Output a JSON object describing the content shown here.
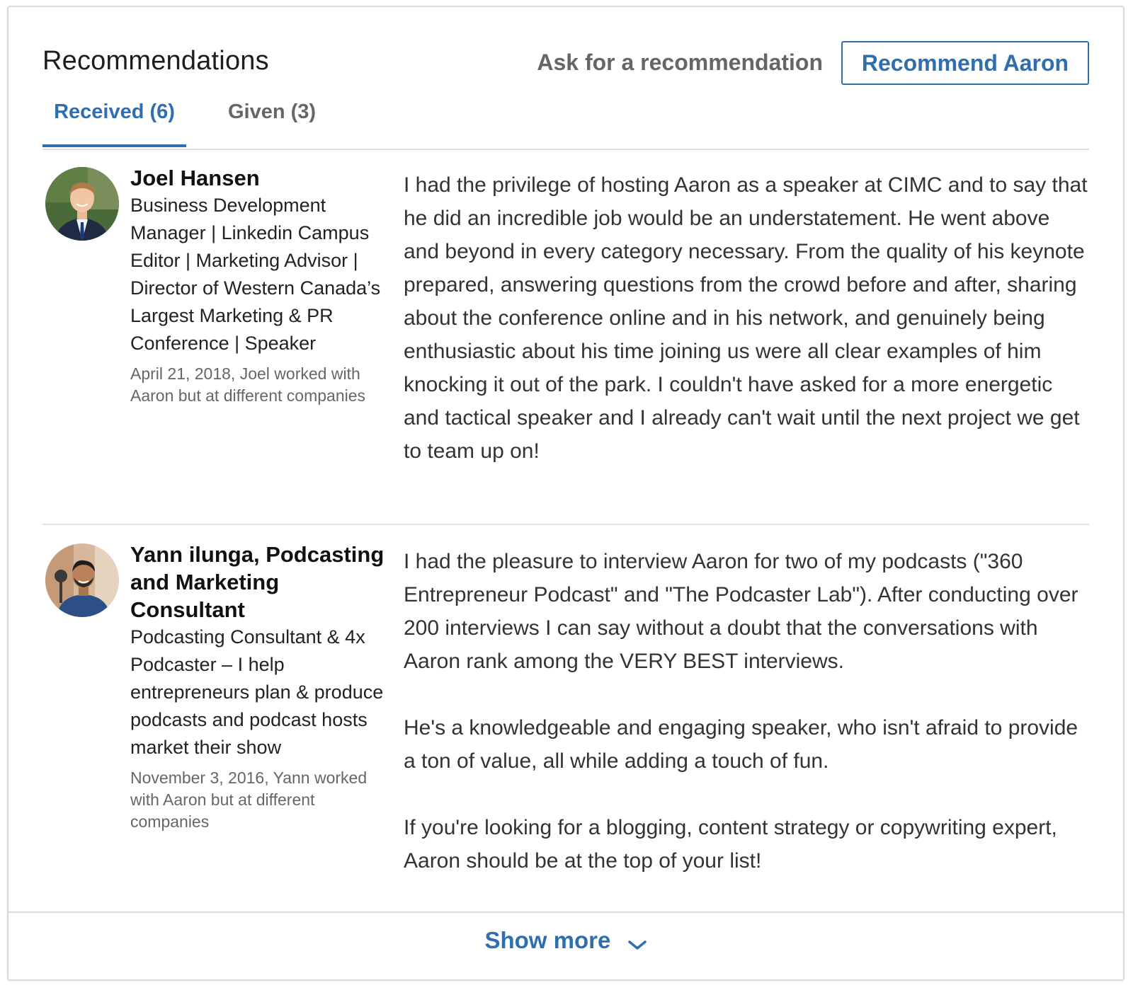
{
  "header": {
    "title": "Recommendations",
    "ask_link": "Ask for a recommendation",
    "recommend_button": "Recommend Aaron"
  },
  "tabs": [
    {
      "label": "Received (6)",
      "active": true
    },
    {
      "label": "Given (3)",
      "active": false
    }
  ],
  "recommendations": [
    {
      "name": "Joel Hansen",
      "headline": "Business Development Manager | Linkedin Campus Editor | Marketing Advisor | Director of Western Canada’s Largest Marketing & PR Conference | Speaker",
      "meta": "April 21, 2018, Joel worked with Aaron but at different companies",
      "paragraphs": [
        "I had the privilege of hosting Aaron as a speaker at CIMC and to say that he did an incredible job would be an understatement. He went above and beyond in every category necessary. From the quality of his keynote prepared, answering questions from the crowd before and after, sharing about the conference online and in his network, and genuinely being enthusiastic about his time joining us were all clear examples of him knocking it out of the park. I couldn't have asked for a more energetic and tactical speaker and I already can't wait until the next project we get to team up on!"
      ]
    },
    {
      "name": "Yann ilunga, Podcasting and Marketing Consultant",
      "headline": "Podcasting Consultant & 4x Podcaster – I help entrepreneurs plan & produce podcasts and podcast hosts market their show",
      "meta": "November 3, 2016, Yann worked with Aaron but at different companies",
      "paragraphs": [
        "I had the pleasure to interview Aaron for two of my podcasts (\"360 Entrepreneur Podcast\" and \"The Podcaster Lab\"). After conducting over 200 interviews I can say without a doubt that the conversations with Aaron rank among the VERY BEST interviews.",
        "He's a knowledgeable and engaging speaker, who isn't afraid to provide a ton of value, all while adding a touch of fun.",
        "If you're looking for a blogging, content strategy or copywriting expert, Aaron should be at the top of your list!"
      ]
    }
  ],
  "footer": {
    "show_more": "Show more",
    "icon": "chevron-down-icon"
  },
  "colors": {
    "accent": "#2f6fb0",
    "muted": "#666666",
    "divider": "#dcdcdc"
  }
}
